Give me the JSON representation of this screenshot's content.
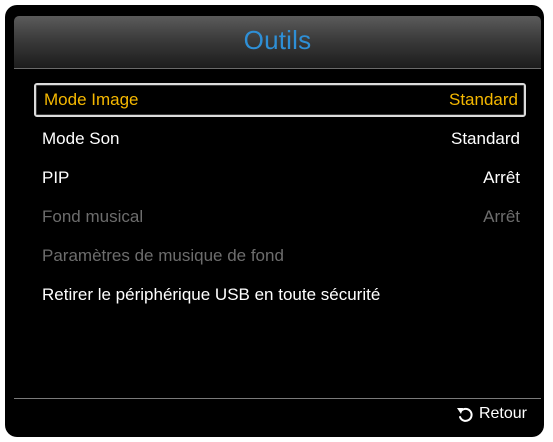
{
  "window": {
    "title": "Outils"
  },
  "menu": {
    "items": [
      {
        "label": "Mode Image",
        "value": "Standard",
        "state": "selected"
      },
      {
        "label": "Mode Son",
        "value": "Standard",
        "state": "normal"
      },
      {
        "label": "PIP",
        "value": "Arrêt",
        "state": "normal"
      },
      {
        "label": "Fond musical",
        "value": "Arrêt",
        "state": "disabled"
      },
      {
        "label": "Paramètres de musique de fond",
        "value": "",
        "state": "disabled"
      },
      {
        "label": "Retirer le périphérique USB en toute sécurité",
        "value": "",
        "state": "normal"
      }
    ]
  },
  "footer": {
    "return_label": "Retour",
    "return_icon": "return-arrow-icon"
  },
  "colors": {
    "title": "#2e8fd6",
    "selected_text": "#f5b800",
    "normal_text": "#ffffff",
    "disabled_text": "#6d6d6d",
    "background": "#000000"
  }
}
